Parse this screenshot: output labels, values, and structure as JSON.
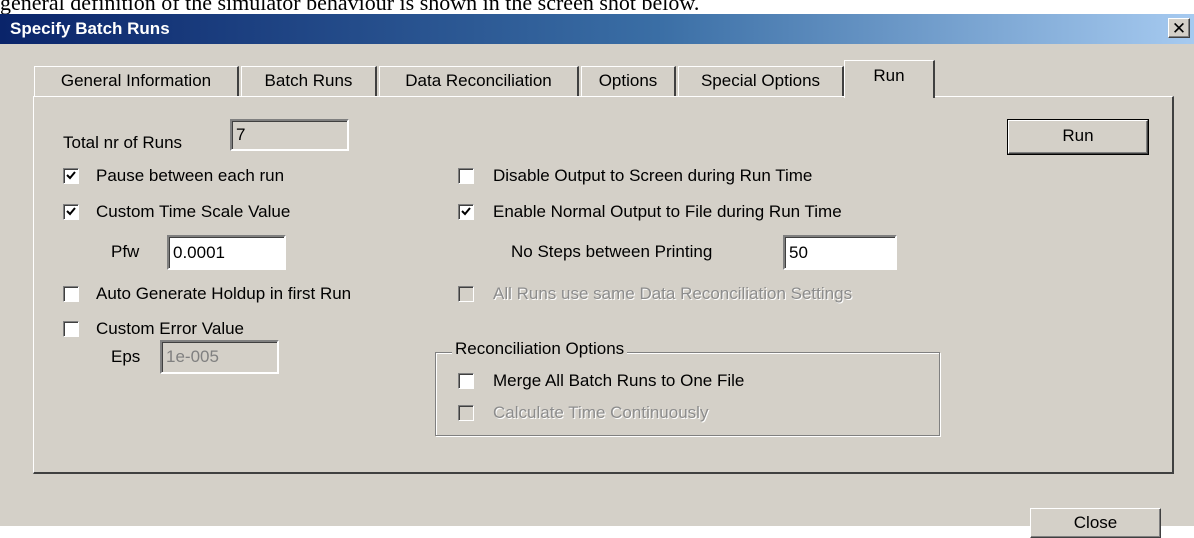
{
  "document": {
    "text_above": "general definition of the simulator behaviour is shown in the screen shot below."
  },
  "window": {
    "title": "Specify Batch Runs",
    "close_glyph": "✕"
  },
  "tabs": [
    {
      "label": "General Information",
      "active": false
    },
    {
      "label": "Batch Runs",
      "active": false
    },
    {
      "label": "Data Reconciliation",
      "active": false
    },
    {
      "label": "Options",
      "active": false
    },
    {
      "label": "Special Options",
      "active": false
    },
    {
      "label": "Run",
      "active": true
    }
  ],
  "run_tab": {
    "total_runs": {
      "label": "Total nr of Runs",
      "value": "7"
    },
    "run_button": "Run",
    "pause_between_runs": {
      "label": "Pause between each run",
      "checked": true,
      "enabled": true
    },
    "custom_time_scale": {
      "label": "Custom Time Scale Value",
      "checked": true,
      "enabled": true
    },
    "pfw": {
      "label": "Pfw",
      "value": "0.0001"
    },
    "auto_generate_holdup": {
      "label": "Auto Generate Holdup in first Run",
      "checked": false,
      "enabled": true
    },
    "custom_error_value": {
      "label": "Custom Error Value",
      "checked": false,
      "enabled": true
    },
    "eps": {
      "label": "Eps",
      "value": "1e-005"
    },
    "disable_output_screen": {
      "label": "Disable Output to Screen during Run Time",
      "checked": false,
      "enabled": true
    },
    "enable_normal_output_file": {
      "label": "Enable Normal Output to File during Run Time",
      "checked": true,
      "enabled": true
    },
    "steps_between_printing": {
      "label": "No Steps between Printing",
      "value": "50"
    },
    "same_data_reconciliation": {
      "label": "All Runs use same Data Reconciliation Settings",
      "checked": false,
      "enabled": false
    },
    "reconciliation_options": {
      "title": "Reconciliation Options",
      "merge_all_batch_runs": {
        "label": "Merge All Batch Runs to One File",
        "checked": false,
        "enabled": true
      },
      "calculate_time_continuously": {
        "label": "Calculate Time Continuously",
        "checked": false,
        "enabled": false
      }
    }
  },
  "close_button": "Close"
}
